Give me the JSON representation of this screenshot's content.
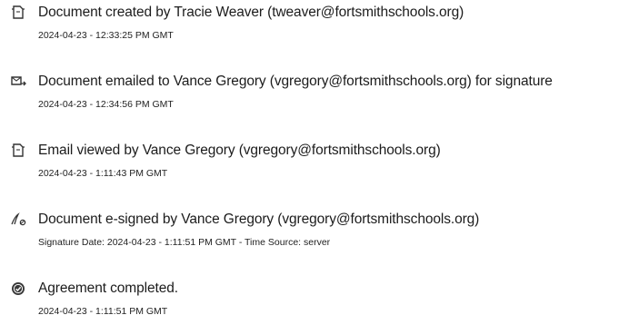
{
  "events": [
    {
      "icon": "document-created-icon",
      "title": "Document created by Tracie Weaver (tweaver@fortsmithschools.org)",
      "detail": "2024-04-23 - 12:33:25 PM GMT"
    },
    {
      "icon": "document-emailed-icon",
      "title": "Document emailed to Vance Gregory (vgregory@fortsmithschools.org) for signature",
      "detail": "2024-04-23 - 12:34:56 PM GMT"
    },
    {
      "icon": "email-viewed-icon",
      "title": "Email viewed by Vance Gregory (vgregory@fortsmithschools.org)",
      "detail": "2024-04-23 - 1:11:43 PM GMT"
    },
    {
      "icon": "signature-pen-icon",
      "title": "Document e-signed by Vance Gregory (vgregory@fortsmithschools.org)",
      "detail": "Signature Date: 2024-04-23 - 1:11:51 PM GMT - Time Source: server"
    },
    {
      "icon": "checkmark-badge-icon",
      "title": "Agreement completed.",
      "detail": "2024-04-23 - 1:11:51 PM GMT"
    }
  ]
}
